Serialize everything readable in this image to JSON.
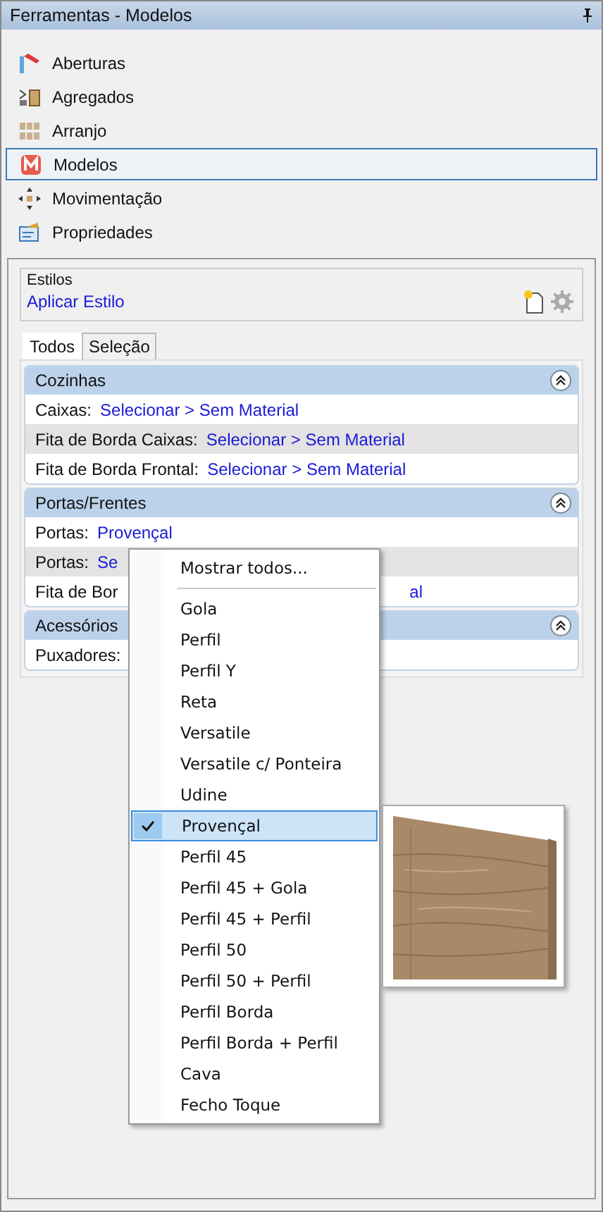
{
  "window": {
    "title": "Ferramentas - Modelos"
  },
  "nav": [
    {
      "label": "Aberturas",
      "kind": "flag",
      "selected": false
    },
    {
      "label": "Agregados",
      "kind": "aggregate",
      "selected": false
    },
    {
      "label": "Arranjo",
      "kind": "grid",
      "selected": false
    },
    {
      "label": "Modelos",
      "kind": "logo",
      "selected": true
    },
    {
      "label": "Movimentação",
      "kind": "move",
      "selected": false
    },
    {
      "label": "Propriedades",
      "kind": "form",
      "selected": false
    }
  ],
  "styles": {
    "legend": "Estilos",
    "link": "Aplicar Estilo"
  },
  "tabs": [
    {
      "label": "Todos",
      "selected": true
    },
    {
      "label": "Seleção",
      "selected": false
    }
  ],
  "sections": [
    {
      "title": "Cozinhas",
      "rows": [
        {
          "label": "Caixas:",
          "value": "Selecionar > Sem Material",
          "shaded": false
        },
        {
          "label": "Fita de Borda Caixas:",
          "value": "Selecionar > Sem Material",
          "shaded": true
        },
        {
          "label": "Fita de Borda Frontal:",
          "value": "Selecionar > Sem Material",
          "shaded": false
        }
      ]
    },
    {
      "title": "Portas/Frentes",
      "rows": [
        {
          "label": "Portas:",
          "value": "Provençal",
          "shaded": false
        },
        {
          "label": "Portas:",
          "value": "Se",
          "shaded": true
        },
        {
          "label": "Fita de Bor",
          "tail": "al",
          "shaded": false
        }
      ]
    },
    {
      "title": "Acessórios",
      "rows": [
        {
          "label": "Puxadores:",
          "shaded": false
        }
      ]
    }
  ],
  "menu": {
    "header": "Mostrar todos...",
    "items": [
      {
        "label": "Gola",
        "selected": false
      },
      {
        "label": "Perfil",
        "selected": false
      },
      {
        "label": "Perfil Y",
        "selected": false
      },
      {
        "label": "Reta",
        "selected": false
      },
      {
        "label": "Versatile",
        "selected": false
      },
      {
        "label": "Versatile c/ Ponteira",
        "selected": false
      },
      {
        "label": "Udine",
        "selected": false
      },
      {
        "label": "Provençal",
        "selected": true
      },
      {
        "label": "Perfil 45",
        "selected": false
      },
      {
        "label": "Perfil 45 + Gola",
        "selected": false
      },
      {
        "label": "Perfil 45 + Perfil",
        "selected": false
      },
      {
        "label": "Perfil 50",
        "selected": false
      },
      {
        "label": "Perfil 50 + Perfil",
        "selected": false
      },
      {
        "label": "Perfil Borda",
        "selected": false
      },
      {
        "label": "Perfil Borda + Perfil",
        "selected": false
      },
      {
        "label": "Cava",
        "selected": false
      },
      {
        "label": "Fecho Toque",
        "selected": false
      }
    ]
  }
}
